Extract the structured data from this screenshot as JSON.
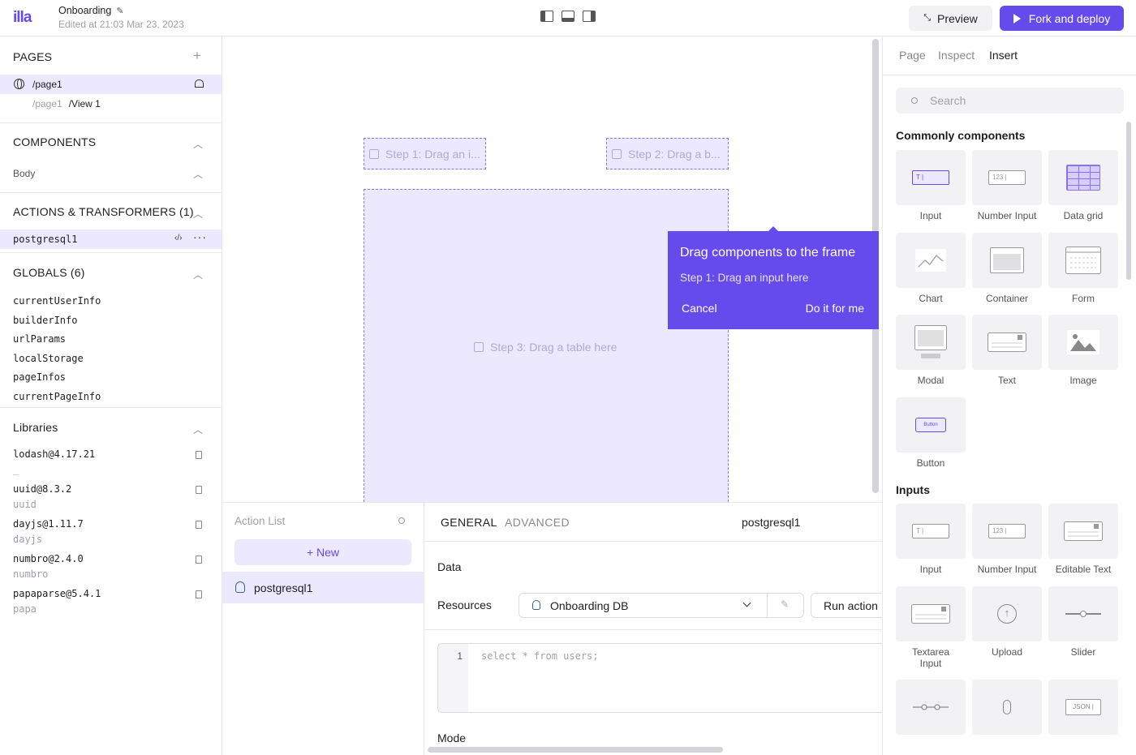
{
  "topbar": {
    "logo": "illa",
    "title": "Onboarding",
    "edited": "Edited at 21:03 Mar 23, 2023",
    "preview": "Preview",
    "deploy": "Fork and deploy"
  },
  "left": {
    "pages_header": "PAGES",
    "page": "/page1",
    "subpage_parent": "/page1",
    "subpage_view": "/View 1",
    "components_header": "COMPONENTS",
    "body": "Body",
    "actions_header": "ACTIONS & TRANSFORMERS (1)",
    "action": "postgresql1",
    "globals_header": "GLOBALS (6)",
    "globals": [
      "currentUserInfo",
      "builderInfo",
      "urlParams",
      "localStorage",
      "pageInfos",
      "currentPageInfo"
    ],
    "libraries_header": "Libraries",
    "libraries": [
      {
        "name": "lodash@4.17.21",
        "alias": "_"
      },
      {
        "name": "uuid@8.3.2",
        "alias": "uuid"
      },
      {
        "name": "dayjs@1.11.7",
        "alias": "dayjs"
      },
      {
        "name": "numbro@2.4.0",
        "alias": "numbro"
      },
      {
        "name": "papaparse@5.4.1",
        "alias": "papa"
      }
    ]
  },
  "canvas": {
    "step1": "Step 1: Drag an i...",
    "step2": "Step 2: Drag a b...",
    "step3": "Step 3: Drag a table here",
    "tip_title": "Drag components to the frame",
    "tip_step": "Step 1: Drag an input here",
    "tip_cancel": "Cancel",
    "tip_do": "Do it for me"
  },
  "actions": {
    "list_title": "Action List",
    "new_label": "+ New",
    "item": "postgresql1"
  },
  "editor": {
    "tab_general": "GENERAL",
    "tab_advanced": "ADVANCED",
    "name": "postgresql1",
    "data_label": "Data",
    "resources_label": "Resources",
    "resource": "Onboarding DB",
    "run": "Run action",
    "line": "1",
    "code": "select * from users;",
    "mode_label": "Mode"
  },
  "right": {
    "tab_page": "Page",
    "tab_inspect": "Inspect",
    "tab_insert": "Insert",
    "search_placeholder": "Search",
    "group_common": "Commonly components",
    "group_inputs": "Inputs",
    "common": [
      "Input",
      "Number Input",
      "Data grid",
      "Chart",
      "Container",
      "Form",
      "Modal",
      "Text",
      "Image",
      "Button"
    ],
    "inputs": [
      "Input",
      "Number Input",
      "Editable Text",
      "Textarea Input",
      "Upload",
      "Slider"
    ],
    "icon_text": {
      "input": "T |",
      "number": "123 |",
      "button": "Button",
      "json": "JSON |"
    }
  },
  "colors": {
    "accent": "#654aec",
    "accent_light": "#ece8fd"
  }
}
